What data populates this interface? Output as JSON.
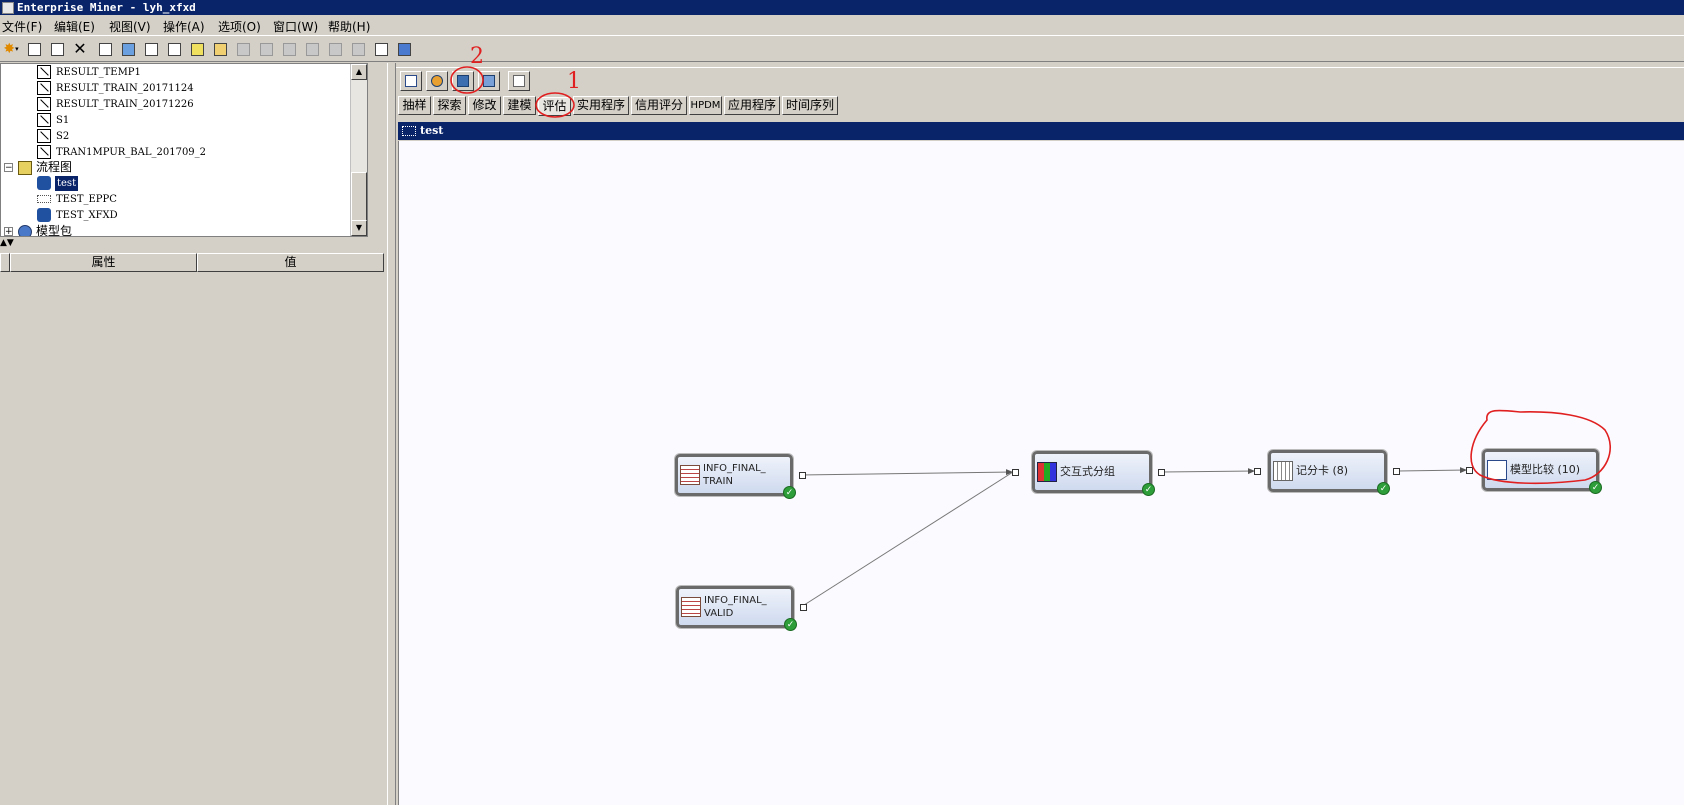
{
  "window": {
    "title": "Enterprise Miner - lyh_xfxd"
  },
  "menu": [
    "文件(F)",
    "编辑(E)",
    "视图(V)",
    "操作(A)",
    "选项(O)",
    "窗口(W)",
    "帮助(H)"
  ],
  "tree": {
    "items": [
      {
        "label": "RESULT_TEMP1",
        "icon": "dataset-icon"
      },
      {
        "label": "RESULT_TRAIN_20171124",
        "icon": "dataset-icon"
      },
      {
        "label": "RESULT_TRAIN_20171226",
        "icon": "dataset-icon"
      },
      {
        "label": "S1",
        "icon": "dataset-icon"
      },
      {
        "label": "S2",
        "icon": "dataset-icon"
      },
      {
        "label": "TRAN1MPUR_BAL_201709_2",
        "icon": "dataset-icon"
      }
    ],
    "diagrams_folder": "流程图",
    "diagrams": [
      {
        "label": "test",
        "selected": true
      },
      {
        "label": "TEST_EPPC",
        "selected": false
      },
      {
        "label": "TEST_XFXD",
        "selected": false
      }
    ],
    "model_packages": "模型包"
  },
  "properties": {
    "col_property": "属性",
    "col_value": "值"
  },
  "tabs": [
    "抽样",
    "探索",
    "修改",
    "建模",
    "评估",
    "实用程序",
    "信用评分",
    "HPDM",
    "应用程序",
    "时间序列"
  ],
  "active_tab": "评估",
  "diagram": {
    "title": "test",
    "nodes": {
      "train": {
        "label": "INFO_FINAL_\nTRAIN",
        "status": "✓"
      },
      "valid": {
        "label": "INFO_FINAL_\nVALID",
        "status": "✓"
      },
      "group": {
        "label": "交互式分组",
        "status": "✓"
      },
      "scorecard": {
        "label": "记分卡 (8)",
        "status": "✓"
      },
      "compare": {
        "label": "模型比较 (10)",
        "status": "✓"
      }
    }
  },
  "annotations": {
    "mark1": "1",
    "mark2": "2"
  },
  "colors": {
    "title_bar": "#0a246a",
    "annotation": "#e02020",
    "check": "#2e9e3a"
  }
}
